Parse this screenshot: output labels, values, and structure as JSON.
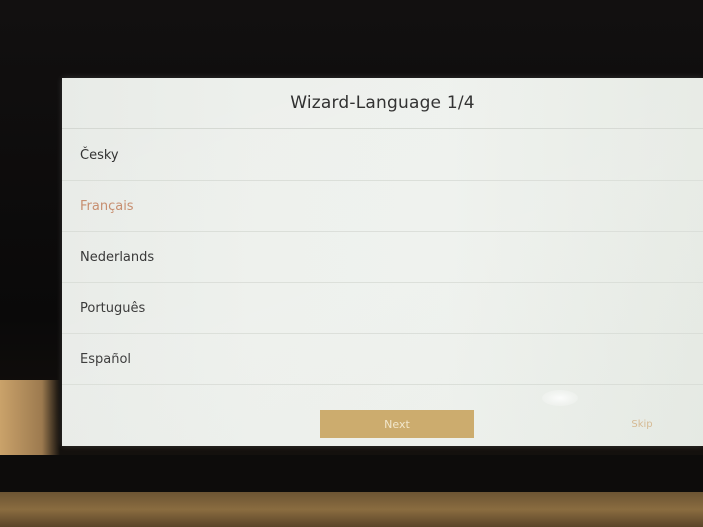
{
  "wizard": {
    "title": "Wizard-Language 1/4"
  },
  "languages": [
    {
      "label": "Česky",
      "selected": false
    },
    {
      "label": "Français",
      "selected": true
    },
    {
      "label": "Nederlands",
      "selected": false
    },
    {
      "label": "Português",
      "selected": false
    },
    {
      "label": "Español",
      "selected": false
    }
  ],
  "footer": {
    "next_label": "Next",
    "skip_label": "Skip"
  },
  "colors": {
    "accent": "#c9a560",
    "selected_text": "#c58a6a"
  }
}
